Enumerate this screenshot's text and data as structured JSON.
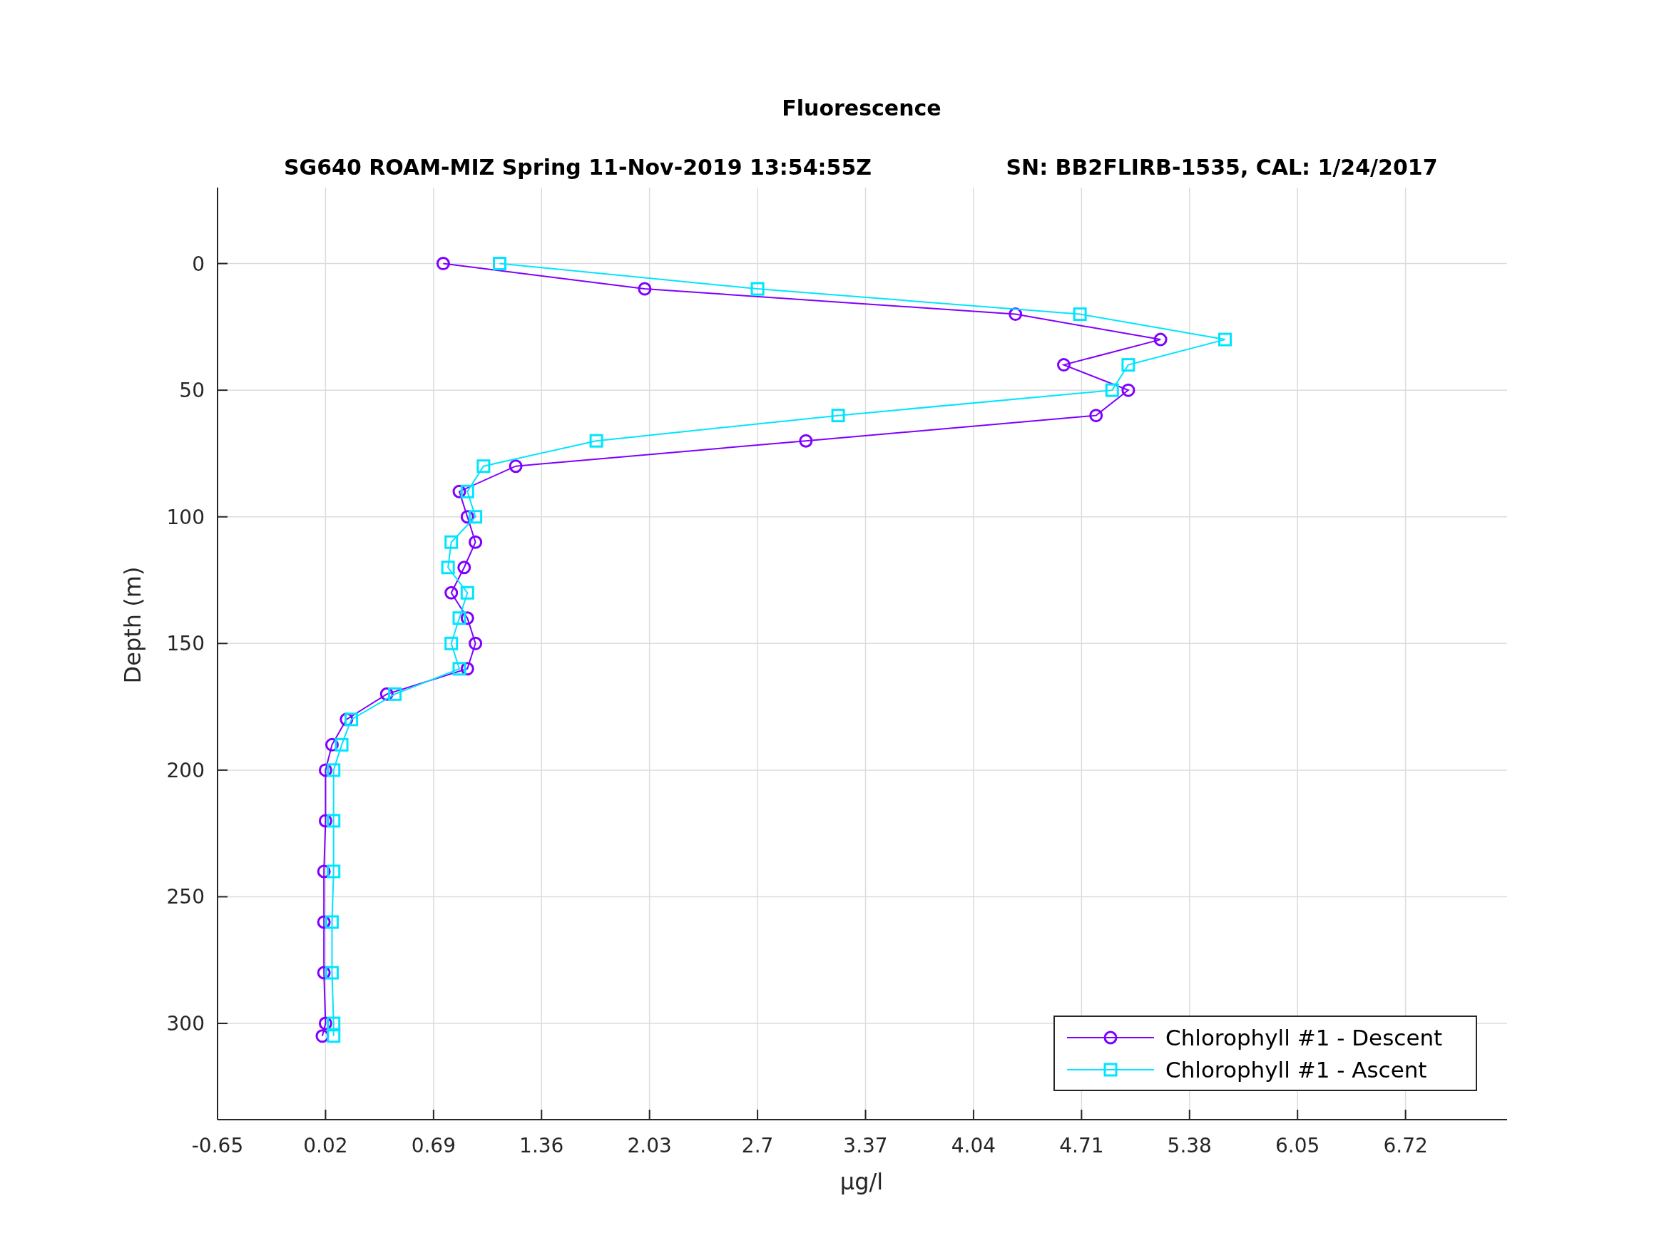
{
  "figure": {
    "title": "Fluorescence",
    "subtitle_left": "SG640 ROAM-MIZ Spring 11-Nov-2019 13:54:55Z",
    "subtitle_right": "SN: BB2FLIRB-1535, CAL: 1/24/2017",
    "chart_data": {
      "type": "line",
      "orientation": "horizontal",
      "xlabel": "μg/l",
      "ylabel": "Depth (m)",
      "x": [
        0,
        10,
        20,
        30,
        40,
        50,
        60,
        70,
        80,
        90,
        100,
        110,
        120,
        130,
        140,
        150,
        160,
        170,
        180,
        190,
        200,
        220,
        240,
        260,
        280,
        300,
        305
      ],
      "series": [
        {
          "name": "Chlorophyll #1 - Descent",
          "color": "#7f00ff",
          "marker": "circle",
          "values": [
            0.75,
            2.0,
            4.3,
            5.2,
            4.6,
            5.0,
            4.8,
            3.0,
            1.2,
            0.85,
            0.9,
            0.95,
            0.88,
            0.8,
            0.9,
            0.95,
            0.9,
            0.4,
            0.15,
            0.06,
            0.02,
            0.02,
            0.01,
            0.01,
            0.01,
            0.02,
            0.0
          ]
        },
        {
          "name": "Chlorophyll #1 - Ascent",
          "color": "#00e5ff",
          "marker": "square",
          "values": [
            1.1,
            2.7,
            4.7,
            5.6,
            5.0,
            4.9,
            3.2,
            1.7,
            1.0,
            0.9,
            0.95,
            0.8,
            0.78,
            0.9,
            0.85,
            0.8,
            0.85,
            0.45,
            0.18,
            0.12,
            0.07,
            0.07,
            0.07,
            0.06,
            0.06,
            0.07,
            0.07
          ]
        }
      ],
      "xlim": [
        -0.65,
        7.35
      ],
      "ylim": [
        338,
        -30
      ],
      "grid": true,
      "legend": "lower right",
      "xticks": [
        {
          "value": -0.65,
          "label": "-0.65"
        },
        {
          "value": 0.02,
          "label": "0.02"
        },
        {
          "value": 0.69,
          "label": "0.69"
        },
        {
          "value": 1.36,
          "label": "1.36"
        },
        {
          "value": 2.03,
          "label": "2.03"
        },
        {
          "value": 2.7,
          "label": "2.7"
        },
        {
          "value": 3.37,
          "label": "3.37"
        },
        {
          "value": 4.04,
          "label": "4.04"
        },
        {
          "value": 4.71,
          "label": "4.71"
        },
        {
          "value": 5.38,
          "label": "5.38"
        },
        {
          "value": 6.05,
          "label": "6.05"
        },
        {
          "value": 6.72,
          "label": "6.72"
        }
      ],
      "yticks": [
        {
          "value": 0,
          "label": "0"
        },
        {
          "value": 50,
          "label": "50"
        },
        {
          "value": 100,
          "label": "100"
        },
        {
          "value": 150,
          "label": "150"
        },
        {
          "value": 200,
          "label": "200"
        },
        {
          "value": 250,
          "label": "250"
        },
        {
          "value": 300,
          "label": "300"
        }
      ]
    }
  }
}
